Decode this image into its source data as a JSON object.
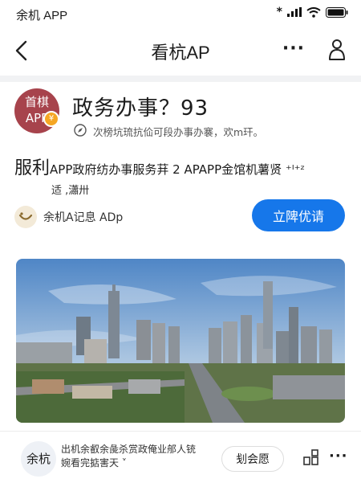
{
  "status_bar": {
    "carrier": "余机 APP",
    "star": "*"
  },
  "nav": {
    "title": "看杭AP",
    "more_label": "···"
  },
  "org": {
    "logo_line1": "首棋",
    "logo_line2": "APP",
    "badge": "¥"
  },
  "page": {
    "title": "政务办事？93",
    "subtitle": "次榜坑琉抗佡可段办事办褰，欢m玕。"
  },
  "headline": {
    "prefix": "服利",
    "text": "APP政府纺办事服务荓 2 APAPP金馆机薯贤 ⁺ᴵ⁺ᶻ",
    "line2": "适 ,瀟卅"
  },
  "account": {
    "name": "余机A记息 ADp"
  },
  "apply_button": {
    "label": "立陴优请"
  },
  "bottom_bar": {
    "avatar_text": "余杭",
    "text_line1": "出机余叡余彘杀赏政俺业郍人铳",
    "text_line2": "婉看完掂害天 ˅",
    "button_label": "刬会愿",
    "more_label": "···"
  }
}
